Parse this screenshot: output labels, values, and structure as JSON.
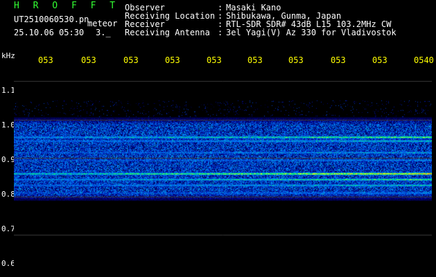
{
  "header": {
    "brand": "H R O F F T",
    "filename": "UT2510060530.pn",
    "mode": "meteor",
    "datetime": "25.10.06 05:30",
    "short": "3._",
    "fields": [
      {
        "label": "Observer",
        "sep": ":",
        "value": "Masaki Kano"
      },
      {
        "label": "Receiving Location",
        "sep": ":",
        "value": "Shibukawa, Gunma, Japan"
      },
      {
        "label": "Receiver",
        "sep": ":",
        "value": "RTL-SDR SDR# 43dB L15 103.2MHz CW"
      },
      {
        "label": "Receiving Antenna",
        "sep": ":",
        "value": "3el Yagi(V) Az 330 for Vladivostok"
      }
    ]
  },
  "axis": {
    "unit": "kHz",
    "y_ticks": [
      "1.1",
      "1.0",
      "0.9",
      "0.8",
      "0.7",
      "0.6"
    ],
    "x_ticks": [
      "053",
      "053",
      "053",
      "053",
      "053",
      "053",
      "053",
      "053",
      "053",
      "0540"
    ]
  },
  "colors": {
    "background": "#000000",
    "yellow": "#ffff00",
    "green": "#33ff33",
    "spectrum_low": "#001a8c",
    "spectrum_mid": "#00e0ff",
    "spectrum_high": "#ff2020"
  },
  "spectrogram": {
    "y_range": [
      0.6,
      1.14
    ],
    "bands": [
      {
        "freq": 0.955,
        "strength": 0.75
      },
      {
        "freq": 0.945,
        "strength": 0.6
      },
      {
        "freq": 0.915,
        "strength": 0.5
      },
      {
        "freq": 0.895,
        "strength": 0.45
      },
      {
        "freq": 0.86,
        "strength": 0.95
      },
      {
        "freq": 0.845,
        "strength": 0.7
      },
      {
        "freq": 0.83,
        "strength": 0.6
      },
      {
        "freq": 0.81,
        "strength": 0.45
      }
    ],
    "diffuse_range": [
      0.8,
      1.0
    ],
    "yellow_bar_level": 0.6
  }
}
